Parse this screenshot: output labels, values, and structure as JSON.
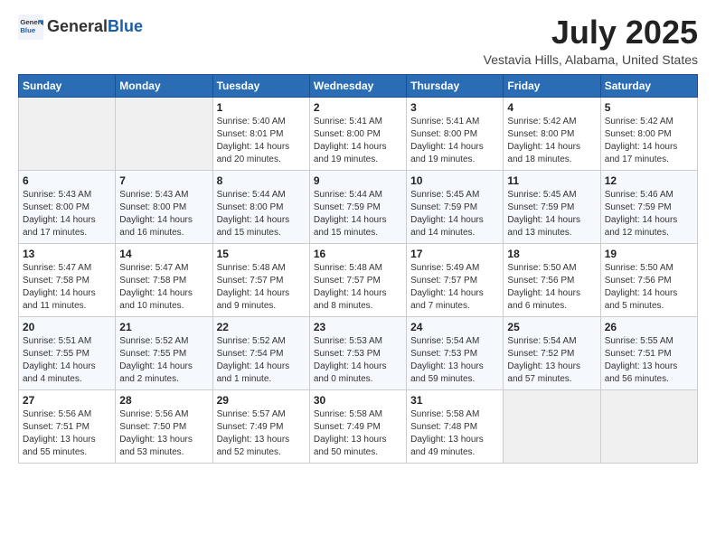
{
  "header": {
    "logo_general": "General",
    "logo_blue": "Blue",
    "month_year": "July 2025",
    "location": "Vestavia Hills, Alabama, United States"
  },
  "weekdays": [
    "Sunday",
    "Monday",
    "Tuesday",
    "Wednesday",
    "Thursday",
    "Friday",
    "Saturday"
  ],
  "weeks": [
    [
      {
        "day": "",
        "empty": true
      },
      {
        "day": "",
        "empty": true
      },
      {
        "day": "1",
        "sunrise": "Sunrise: 5:40 AM",
        "sunset": "Sunset: 8:01 PM",
        "daylight": "Daylight: 14 hours and 20 minutes."
      },
      {
        "day": "2",
        "sunrise": "Sunrise: 5:41 AM",
        "sunset": "Sunset: 8:00 PM",
        "daylight": "Daylight: 14 hours and 19 minutes."
      },
      {
        "day": "3",
        "sunrise": "Sunrise: 5:41 AM",
        "sunset": "Sunset: 8:00 PM",
        "daylight": "Daylight: 14 hours and 19 minutes."
      },
      {
        "day": "4",
        "sunrise": "Sunrise: 5:42 AM",
        "sunset": "Sunset: 8:00 PM",
        "daylight": "Daylight: 14 hours and 18 minutes."
      },
      {
        "day": "5",
        "sunrise": "Sunrise: 5:42 AM",
        "sunset": "Sunset: 8:00 PM",
        "daylight": "Daylight: 14 hours and 17 minutes."
      }
    ],
    [
      {
        "day": "6",
        "sunrise": "Sunrise: 5:43 AM",
        "sunset": "Sunset: 8:00 PM",
        "daylight": "Daylight: 14 hours and 17 minutes."
      },
      {
        "day": "7",
        "sunrise": "Sunrise: 5:43 AM",
        "sunset": "Sunset: 8:00 PM",
        "daylight": "Daylight: 14 hours and 16 minutes."
      },
      {
        "day": "8",
        "sunrise": "Sunrise: 5:44 AM",
        "sunset": "Sunset: 8:00 PM",
        "daylight": "Daylight: 14 hours and 15 minutes."
      },
      {
        "day": "9",
        "sunrise": "Sunrise: 5:44 AM",
        "sunset": "Sunset: 7:59 PM",
        "daylight": "Daylight: 14 hours and 15 minutes."
      },
      {
        "day": "10",
        "sunrise": "Sunrise: 5:45 AM",
        "sunset": "Sunset: 7:59 PM",
        "daylight": "Daylight: 14 hours and 14 minutes."
      },
      {
        "day": "11",
        "sunrise": "Sunrise: 5:45 AM",
        "sunset": "Sunset: 7:59 PM",
        "daylight": "Daylight: 14 hours and 13 minutes."
      },
      {
        "day": "12",
        "sunrise": "Sunrise: 5:46 AM",
        "sunset": "Sunset: 7:59 PM",
        "daylight": "Daylight: 14 hours and 12 minutes."
      }
    ],
    [
      {
        "day": "13",
        "sunrise": "Sunrise: 5:47 AM",
        "sunset": "Sunset: 7:58 PM",
        "daylight": "Daylight: 14 hours and 11 minutes."
      },
      {
        "day": "14",
        "sunrise": "Sunrise: 5:47 AM",
        "sunset": "Sunset: 7:58 PM",
        "daylight": "Daylight: 14 hours and 10 minutes."
      },
      {
        "day": "15",
        "sunrise": "Sunrise: 5:48 AM",
        "sunset": "Sunset: 7:57 PM",
        "daylight": "Daylight: 14 hours and 9 minutes."
      },
      {
        "day": "16",
        "sunrise": "Sunrise: 5:48 AM",
        "sunset": "Sunset: 7:57 PM",
        "daylight": "Daylight: 14 hours and 8 minutes."
      },
      {
        "day": "17",
        "sunrise": "Sunrise: 5:49 AM",
        "sunset": "Sunset: 7:57 PM",
        "daylight": "Daylight: 14 hours and 7 minutes."
      },
      {
        "day": "18",
        "sunrise": "Sunrise: 5:50 AM",
        "sunset": "Sunset: 7:56 PM",
        "daylight": "Daylight: 14 hours and 6 minutes."
      },
      {
        "day": "19",
        "sunrise": "Sunrise: 5:50 AM",
        "sunset": "Sunset: 7:56 PM",
        "daylight": "Daylight: 14 hours and 5 minutes."
      }
    ],
    [
      {
        "day": "20",
        "sunrise": "Sunrise: 5:51 AM",
        "sunset": "Sunset: 7:55 PM",
        "daylight": "Daylight: 14 hours and 4 minutes."
      },
      {
        "day": "21",
        "sunrise": "Sunrise: 5:52 AM",
        "sunset": "Sunset: 7:55 PM",
        "daylight": "Daylight: 14 hours and 2 minutes."
      },
      {
        "day": "22",
        "sunrise": "Sunrise: 5:52 AM",
        "sunset": "Sunset: 7:54 PM",
        "daylight": "Daylight: 14 hours and 1 minute."
      },
      {
        "day": "23",
        "sunrise": "Sunrise: 5:53 AM",
        "sunset": "Sunset: 7:53 PM",
        "daylight": "Daylight: 14 hours and 0 minutes."
      },
      {
        "day": "24",
        "sunrise": "Sunrise: 5:54 AM",
        "sunset": "Sunset: 7:53 PM",
        "daylight": "Daylight: 13 hours and 59 minutes."
      },
      {
        "day": "25",
        "sunrise": "Sunrise: 5:54 AM",
        "sunset": "Sunset: 7:52 PM",
        "daylight": "Daylight: 13 hours and 57 minutes."
      },
      {
        "day": "26",
        "sunrise": "Sunrise: 5:55 AM",
        "sunset": "Sunset: 7:51 PM",
        "daylight": "Daylight: 13 hours and 56 minutes."
      }
    ],
    [
      {
        "day": "27",
        "sunrise": "Sunrise: 5:56 AM",
        "sunset": "Sunset: 7:51 PM",
        "daylight": "Daylight: 13 hours and 55 minutes."
      },
      {
        "day": "28",
        "sunrise": "Sunrise: 5:56 AM",
        "sunset": "Sunset: 7:50 PM",
        "daylight": "Daylight: 13 hours and 53 minutes."
      },
      {
        "day": "29",
        "sunrise": "Sunrise: 5:57 AM",
        "sunset": "Sunset: 7:49 PM",
        "daylight": "Daylight: 13 hours and 52 minutes."
      },
      {
        "day": "30",
        "sunrise": "Sunrise: 5:58 AM",
        "sunset": "Sunset: 7:49 PM",
        "daylight": "Daylight: 13 hours and 50 minutes."
      },
      {
        "day": "31",
        "sunrise": "Sunrise: 5:58 AM",
        "sunset": "Sunset: 7:48 PM",
        "daylight": "Daylight: 13 hours and 49 minutes."
      },
      {
        "day": "",
        "empty": true
      },
      {
        "day": "",
        "empty": true
      }
    ]
  ]
}
